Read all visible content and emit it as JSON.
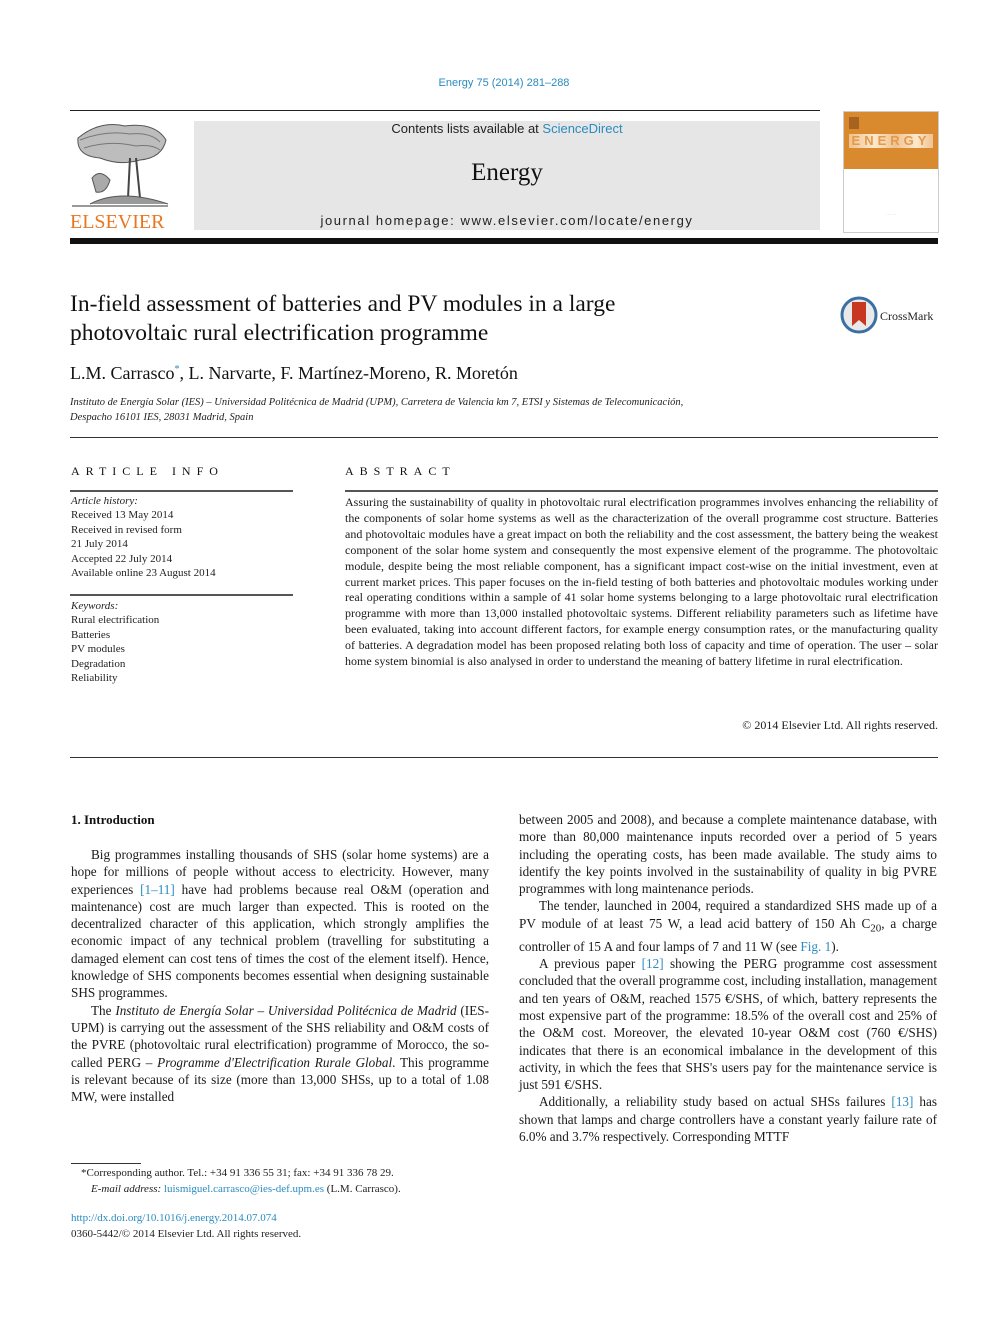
{
  "header": {
    "citation": "Energy 75 (2014) 281–288",
    "contents_prefix": "Contents lists available at ",
    "contents_link": "ScienceDirect",
    "journal_name": "Energy",
    "homepage": "journal homepage: www.elsevier.com/locate/energy",
    "publisher_logo_text": "ELSEVIER",
    "cover_title": "ENERGY",
    "brand_color": "#e87722",
    "link_color": "#2a8bbf"
  },
  "article": {
    "title_line1": "In-field assessment of batteries and PV modules in a large",
    "title_line2": "photovoltaic rural electrification programme",
    "crossmark_label": "CrossMark",
    "authors": [
      {
        "name": "L.M. Carrasco",
        "mark": "*"
      },
      {
        "name": ", L. Narvarte, F. Martínez-Moreno, R. Moretón",
        "mark": ""
      }
    ],
    "affiliation_line1": "Instituto de Energía Solar (IES) – Universidad Politécnica de Madrid (UPM), Carretera de Valencia km 7, ETSI y Sistemas de Telecomunicación,",
    "affiliation_line2": "Despacho 16101 IES, 28031 Madrid, Spain"
  },
  "article_info": {
    "heading": "ARTICLE INFO",
    "history_label": "Article history:",
    "history": [
      "Received 13 May 2014",
      "Received in revised form",
      "21 July 2014",
      "Accepted 22 July 2014",
      "Available online 23 August 2014"
    ],
    "keywords_label": "Keywords:",
    "keywords": [
      "Rural electrification",
      "Batteries",
      "PV modules",
      "Degradation",
      "Reliability"
    ]
  },
  "abstract": {
    "heading": "ABSTRACT",
    "text": "Assuring the sustainability of quality in photovoltaic rural electrification programmes involves enhancing the reliability of the components of solar home systems as well as the characterization of the overall programme cost structure. Batteries and photovoltaic modules have a great impact on both the reliability and the cost assessment, the battery being the weakest component of the solar home system and consequently the most expensive element of the programme. The photovoltaic module, despite being the most reliable component, has a significant impact cost-wise on the initial investment, even at current market prices. This paper focuses on the in-field testing of both batteries and photovoltaic modules working under real operating conditions within a sample of 41 solar home systems belonging to a large photovoltaic rural electrification programme with more than 13,000 installed photovoltaic systems. Different reliability parameters such as lifetime have been evaluated, taking into account different factors, for example energy consumption rates, or the manufacturing quality of batteries. A degradation model has been proposed relating both loss of capacity and time of operation. The user – solar home system binomial is also analysed in order to understand the meaning of battery lifetime in rural electrification.",
    "copyright": "© 2014 Elsevier Ltd. All rights reserved."
  },
  "body": {
    "section_heading": "1.  Introduction",
    "left": {
      "p1_a": "Big programmes installing thousands of SHS (solar home systems) are a hope for millions of people without access to electricity. However, many experiences ",
      "p1_ref": "[1–11]",
      "p1_b": " have had problems because real O&M (operation and maintenance) cost are much larger than expected. This is rooted on the decentralized character of this application, which strongly amplifies the economic impact of any technical problem (travelling for substituting a damaged element can cost tens of times the cost of the element itself). Hence, knowledge of SHS components becomes essential when designing sustainable SHS programmes.",
      "p2_a": "The ",
      "p2_italic1": "Instituto de Energía Solar – Universidad Politécnica de Madrid",
      "p2_b": " (IES-UPM) is carrying out the assessment of the SHS reliability and O&M costs of the PVRE (photovoltaic rural electrification) programme of Morocco, the so-called PERG – ",
      "p2_italic2": "Programme d'Electrification Rurale Global",
      "p2_c": ". This programme is relevant because of its size (more than 13,000 SHSs, up to a total of 1.08 MW, were installed"
    },
    "right": {
      "p0": "between 2005 and 2008), and because a complete maintenance database, with more than 80,000 maintenance inputs recorded over a period of 5 years including the operating costs, has been made available. The study aims to identify the key points involved in the sustainability of quality in big PVRE programmes with long maintenance periods.",
      "p1_a": "The tender, launched in 2004, required a standardized SHS made up of a PV module of at least 75 W, a lead acid battery of 150 Ah C",
      "p1_sub": "20",
      "p1_b": ", a charge controller of 15 A and four lamps of 7 and 11 W (see ",
      "p1_ref": "Fig. 1",
      "p1_c": ").",
      "p2_a": "A previous paper ",
      "p2_ref": "[12]",
      "p2_b": " showing the PERG programme cost assessment concluded that the overall programme cost, including installation, management and ten years of O&M, reached 1575 €/SHS, of which, battery represents the most expensive part of the programme: 18.5% of the overall cost and 25% of the O&M cost. Moreover, the elevated 10-year O&M cost (760 €/SHS) indicates that there is an economical imbalance in the development of this activity, in which the fees that SHS's users pay for the maintenance service is just 591 €/SHS.",
      "p3_a": "Additionally, a reliability study based on actual SHSs failures ",
      "p3_ref": "[13]",
      "p3_b": " has shown that lamps and charge controllers have a constant yearly failure rate of 6.0% and 3.7% respectively. Corresponding MTTF"
    }
  },
  "footnote": {
    "corresponding": "*Corresponding author.  Tel.: +34 91 336 55 31; fax: +34 91 336 78 29.",
    "email_label": "E-mail address: ",
    "email": "luismiguel.carrasco@ies-def.upm.es",
    "email_suffix": " (L.M. Carrasco).",
    "doi": "http://dx.doi.org/10.1016/j.energy.2014.07.074",
    "issn": "0360-5442/© 2014 Elsevier Ltd. All rights reserved."
  }
}
